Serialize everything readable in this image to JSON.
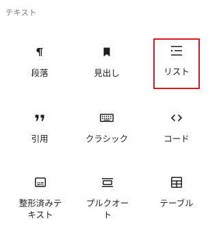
{
  "section": {
    "title": "テキスト"
  },
  "blocks": [
    {
      "label": "段落",
      "icon": "paragraph-icon"
    },
    {
      "label": "見出し",
      "icon": "heading-bookmark-icon"
    },
    {
      "label": "リスト",
      "icon": "list-icon",
      "selected": true
    },
    {
      "label": "引用",
      "icon": "quote-icon"
    },
    {
      "label": "クラシック",
      "icon": "keyboard-icon"
    },
    {
      "label": "コード",
      "icon": "code-icon"
    },
    {
      "label": "整形済みテキスト",
      "icon": "preformatted-icon"
    },
    {
      "label": "プルクオート",
      "icon": "pullquote-icon"
    },
    {
      "label": "テーブル",
      "icon": "table-icon"
    }
  ],
  "colors": {
    "selected_border": "#d9151e",
    "icon": "#1e1e1e",
    "section_title": "#757575"
  }
}
